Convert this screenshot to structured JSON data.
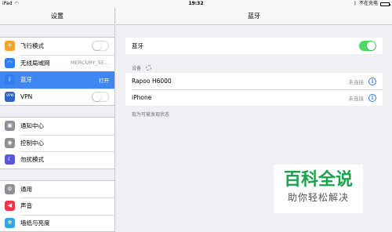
{
  "status_bar": {
    "device": "iPad",
    "time": "19:32",
    "charging": "不在充电"
  },
  "sidebar": {
    "title": "设置",
    "groups": [
      {
        "items": [
          {
            "label": "飞行模式",
            "icon": "airplane-icon",
            "color": "#f7a22c",
            "glyph": "✈",
            "toggle": false
          },
          {
            "label": "无线局域网",
            "value": "MERCURY_5E...",
            "icon": "wifi-icon",
            "color": "#2f7ff0",
            "glyph": "◠"
          },
          {
            "label": "蓝牙",
            "value": "打开",
            "icon": "bluetooth-icon",
            "color": "#2f7ff0",
            "glyph": "ᛒ",
            "selected": true
          },
          {
            "label": "VPN",
            "icon": "vpn-icon",
            "color": "#2f63c7",
            "glyph": "VPN",
            "toggle": false
          }
        ]
      },
      {
        "items": [
          {
            "label": "通知中心",
            "icon": "notification-center-icon",
            "color": "#8e8e93",
            "glyph": "▣"
          },
          {
            "label": "控制中心",
            "icon": "control-center-icon",
            "color": "#8e8e93",
            "glyph": "◉"
          },
          {
            "label": "勿扰模式",
            "icon": "do-not-disturb-moon-icon",
            "color": "#5a58d6",
            "glyph": "☾"
          }
        ]
      },
      {
        "items": [
          {
            "label": "通用",
            "icon": "gear-icon",
            "color": "#8e8e93",
            "glyph": "⚙"
          },
          {
            "label": "声音",
            "icon": "speaker-icon",
            "color": "#f0344a",
            "glyph": "◀"
          },
          {
            "label": "墙纸与亮度",
            "icon": "wallpaper-icon",
            "color": "#2ea8e8",
            "glyph": "✻"
          }
        ]
      }
    ]
  },
  "main": {
    "title": "蓝牙",
    "bluetooth_toggle": {
      "label": "蓝牙",
      "on": true
    },
    "devices_header": "设备",
    "devices": [
      {
        "name": "Rapoo H6000",
        "status": "未连接"
      },
      {
        "name": "iPhone",
        "status": "未连接"
      }
    ],
    "discoverable_note": "现为可被发现状态"
  },
  "watermark": {
    "title": "百科全说",
    "subtitle": "助你轻松解决"
  },
  "colors": {
    "accent": "#3f86f0",
    "toggle_on": "#4cd964",
    "watermark_green": "#1aa34a"
  }
}
